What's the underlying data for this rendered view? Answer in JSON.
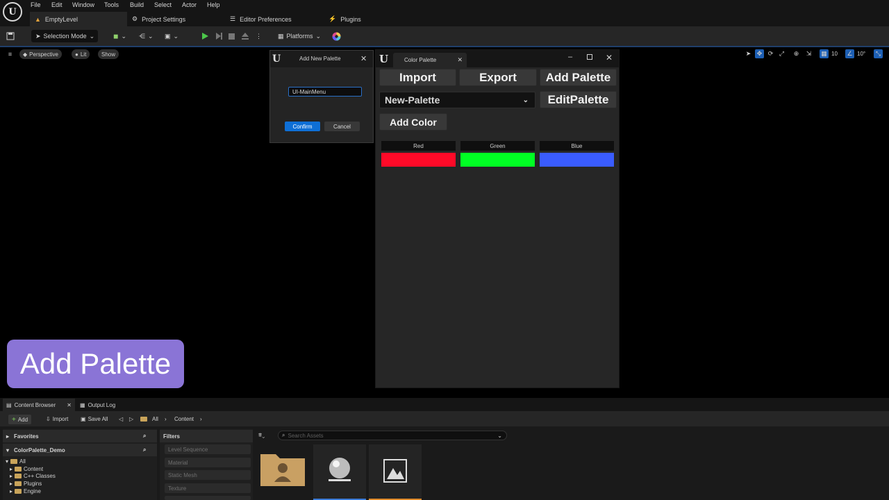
{
  "menu": [
    "File",
    "Edit",
    "Window",
    "Tools",
    "Build",
    "Select",
    "Actor",
    "Help"
  ],
  "tabs": {
    "level": "EmptyLevel",
    "project_settings": "Project Settings",
    "editor_prefs": "Editor Preferences",
    "plugins": "Plugins"
  },
  "toolbar": {
    "selection_mode": "Selection Mode",
    "platforms": "Platforms"
  },
  "viewport": {
    "perspective": "Perspective",
    "lit": "Lit",
    "show": "Show",
    "grid_snap": "10",
    "rot_snap": "10°"
  },
  "dialog": {
    "title": "Add New Palette",
    "input_value": "UI-MainMenu",
    "confirm": "Confirm",
    "cancel": "Cancel"
  },
  "palette_window": {
    "tab": "Color Palette",
    "import": "Import",
    "export": "Export",
    "add_palette": "Add Palette",
    "edit_palette": "EditPalette",
    "selected_palette": "New-Palette",
    "add_color": "Add Color",
    "colors": [
      {
        "name": "Red",
        "hex": "#ff0a28"
      },
      {
        "name": "Green",
        "hex": "#00ff24"
      },
      {
        "name": "Blue",
        "hex": "#3a5cff"
      }
    ]
  },
  "overlay_label": "Add Palette",
  "bottom": {
    "content_browser": "Content Browser",
    "output_log": "Output Log",
    "add": "Add",
    "import": "Import",
    "save_all": "Save All",
    "crumb_all": "All",
    "crumb_content": "Content",
    "favorites": "Favorites",
    "project": "ColorPalette_Demo",
    "tree": [
      "All",
      "Content",
      "C++ Classes",
      "Plugins",
      "Engine"
    ],
    "filters_title": "Filters",
    "filters": [
      "Level Sequence",
      "Material",
      "Static Mesh",
      "Texture"
    ],
    "search_placeholder": "Search Assets"
  },
  "colors": {
    "accent": "#0e6fd6",
    "panel": "#262626",
    "overlay": "#8a74d6"
  }
}
